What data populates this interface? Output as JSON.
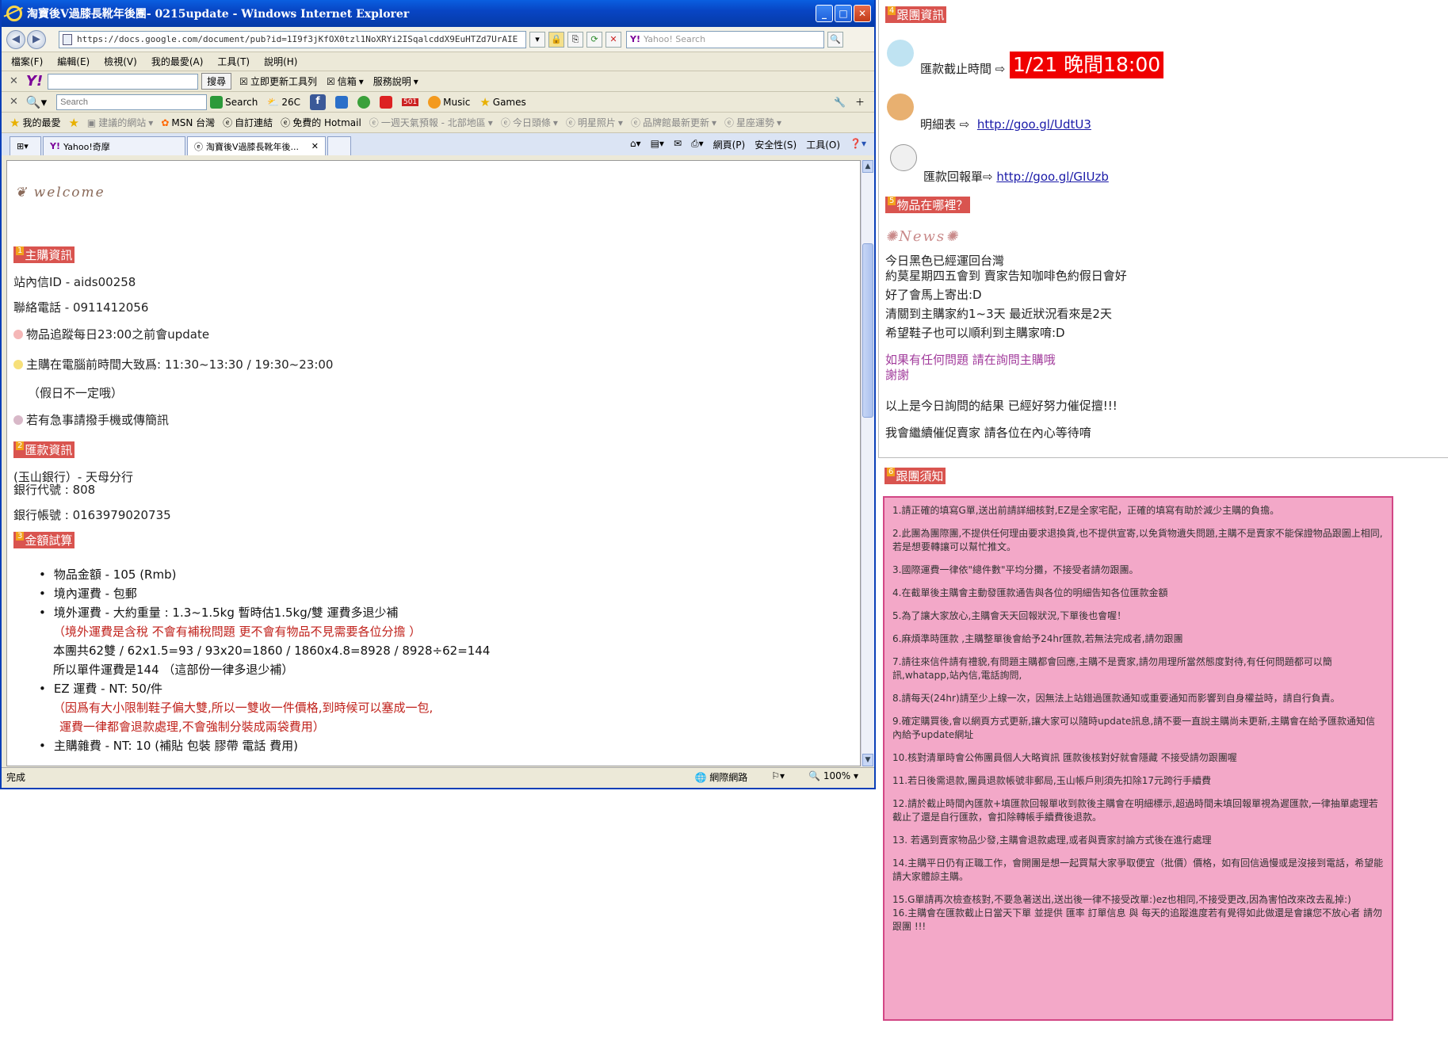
{
  "window": {
    "title": "淘寶後V過膝長靴年後團- 0215update - Windows Internet Explorer",
    "min": "_",
    "max": "□",
    "close": "✕"
  },
  "address": {
    "url": "https://docs.google.com/document/pub?id=1I9f3jKfOX0tzl1NoXRYi2ISqalcddX9EuHTZd7UrAIE",
    "search_placeholder": "Yahoo! Search"
  },
  "menu": [
    "檔案(F)",
    "編輯(E)",
    "檢視(V)",
    "我的最愛(A)",
    "工具(T)",
    "說明(H)"
  ],
  "yahoo_toolbar": {
    "search_btn": "搜尋",
    "items": [
      "立即更新工具列",
      "信箱",
      "服務說明"
    ]
  },
  "search_toolbar": {
    "placeholder": "Search",
    "search": "Search",
    "temp": "26C",
    "mail_count": "501",
    "music": "Music",
    "games": "Games"
  },
  "favorites": {
    "label": "我的最愛",
    "items": [
      "建議的網站",
      "MSN 台灣",
      "自訂連結",
      "免費的 Hotmail",
      "一週天氣預報 - 北部地區",
      "今日頭條",
      "明星照片",
      "品牌館最新更新",
      "星座運勢"
    ]
  },
  "tabs": [
    {
      "label": "Yahoo!奇摩"
    },
    {
      "label": "淘寶後V過膝長靴年後..."
    }
  ],
  "commands": [
    "網頁(P)",
    "安全性(S)",
    "工具(O)"
  ],
  "status": {
    "text": "完成",
    "zone": "網際網路",
    "zoom": "100%"
  },
  "content": {
    "welcome": "welcome",
    "sec1": {
      "num": "1",
      "title": "主購資訊"
    },
    "id_line": "站內信ID - aids00258",
    "phone_line": "聯絡電話 - 0911412056",
    "note1": "物品追蹤每日23:00之前會update",
    "note2": "主購在電腦前時間大致爲: 11:30~13:30 / 19:30~23:00",
    "note3": "（假日不一定哦）",
    "note4": "若有急事請撥手機或傳簡訊",
    "sec2": {
      "num": "2",
      "title": "匯款資訊"
    },
    "bank_name": "(玉山銀行）- 天母分行",
    "bank_code": "銀行代號 : 808",
    "bank_acct": "銀行帳號 : 0163979020735",
    "sec3": {
      "num": "3",
      "title": "金額試算"
    },
    "cost": {
      "l1": "物品金額 - 105 (Rmb)",
      "l2": "境內運費 - 包郵",
      "l3": "境外運費  - 大約重量  : 1.3~1.5kg 暫時估1.5kg/雙 運費多退少補",
      "l4": "（境外運費是含稅 不會有補稅問題 更不會有物品不見需要各位分擔 ）",
      "l5": "本團共62雙 / 62x1.5=93 / 93x20=1860 / 1860x4.8=8928 / 8928÷62=144",
      "l6": "所以單件運費是144 （這部份一律多退少補）",
      "l7": "EZ  運費  - NT: 50/件",
      "l8": "（因爲有大小限制鞋子偏大雙,所以一雙收一件價格,到時候可以塞成一包,",
      "l9": "運費一律都會退款處理,不會強制分裝成兩袋費用）",
      "l10": "主購雜費 - NT: 10 (補貼 包裝 膠帶 電話 費用)"
    }
  },
  "right": {
    "sec4": {
      "num": "4",
      "title": "跟團資訊"
    },
    "deadline_label": "匯款截止時間",
    "deadline_value": "1/21 晚間18:00",
    "detail_label": "明細表",
    "detail_link": "http://goo.gl/UdtU3",
    "reply_label": "匯款回報單",
    "reply_link": "http://goo.gl/GIUzb",
    "sec5": {
      "num": "5",
      "title": "物品在哪裡？"
    },
    "news_logo": "News",
    "news": {
      "n1": "今日黑色已經運回台灣",
      "n2": "約莫星期四五會到 賣家告知咖啡色約假日會好",
      "n3": "好了會馬上寄出:D",
      "n4": "清關到主購家約1~3天 最近狀況看來是2天",
      "n5": "希望鞋子也可以順利到主購家唷:D",
      "n6": "如果有任何問題 請在詢問主購哦",
      "n7": "謝謝",
      "n8": "以上是今日詢問的結果 已經好努力催促擅!!!",
      "n9": "我會繼續催促賣家 請各位在內心等待唷"
    },
    "sec6": {
      "num": "6",
      "title": "跟團須知"
    },
    "rules": [
      "1.請正確的填寫G單,送出前請詳細核對,EZ是全家宅配，正確的填寫有助於減少主購的負擔。",
      "2.此團為團際團,不提供任何理由要求退換貨,也不提供宣寄,以免貨物遺失問題,主購不是賣家不能保證物品跟圖上相同,若是想要轉讓可以幫忙推文。",
      "3.國際運費一律依\"總件數\"平均分攤，不接受者請勿跟團。",
      "4.在截單後主購會主動發匯款通告與各位的明細告知各位匯款金額",
      "5.為了讓大家放心,主購會天天回報狀況,下單後也會喔！",
      "6.麻煩準時匯款 ,主購整單後會給予24hr匯款,若無法完成者,請勿跟團",
      "7.請往來信件請有禮貌,有問題主購都會回應,主購不是賣家,請勿用理所當然態度對待,有任何問題都可以簡訊,whatapp,站內信,電話詢問,",
      "8.請每天(24hr)請至少上線一次，因無法上站錯過匯款通知或重要通知而影響到自身權益時，請自行負責。",
      "9.確定購買後,會以網頁方式更新,讓大家可以隨時update訊息,請不要一直說主購尚未更新,主購會在給予匯款通知信內給予update網址",
      "10.核對清單時會公佈團員個人大略資訊 匯款後核對好就會隱藏 不接受請勿跟團喔",
      "11.若日後需退款,團員退款帳號非郵局,玉山帳戶則須先扣除17元跨行手續費",
      "12.請於截止時間內匯款+填匯款回報單收到款後主購會在明細標示,超過時間未填回報單視為遲匯款,一律抽單處理若截止了還是自行匯款，會扣除轉帳手續費後退款。",
      "13. 若遇到賣家物品少發,主購會退款處理,或者與賣家討論方式後在進行處理",
      "14.主購平日仍有正職工作，會開團是想一起買幫大家爭取便宜（批價）價格，如有回信過慢或是沒接到電話，希望能請大家體諒主購。",
      "15.G單請再次檢查核對,不要急著送出,送出後一律不接受改單:)ez也相同,不接受更改,因為害怕改來改去亂掉:)",
      "16.主購會在匯款截止日當天下單 並提供 匯率 訂單信息 與 每天的追蹤進度若有覺得如此做還是會讓您不放心者 請勿跟團 !!!"
    ]
  }
}
